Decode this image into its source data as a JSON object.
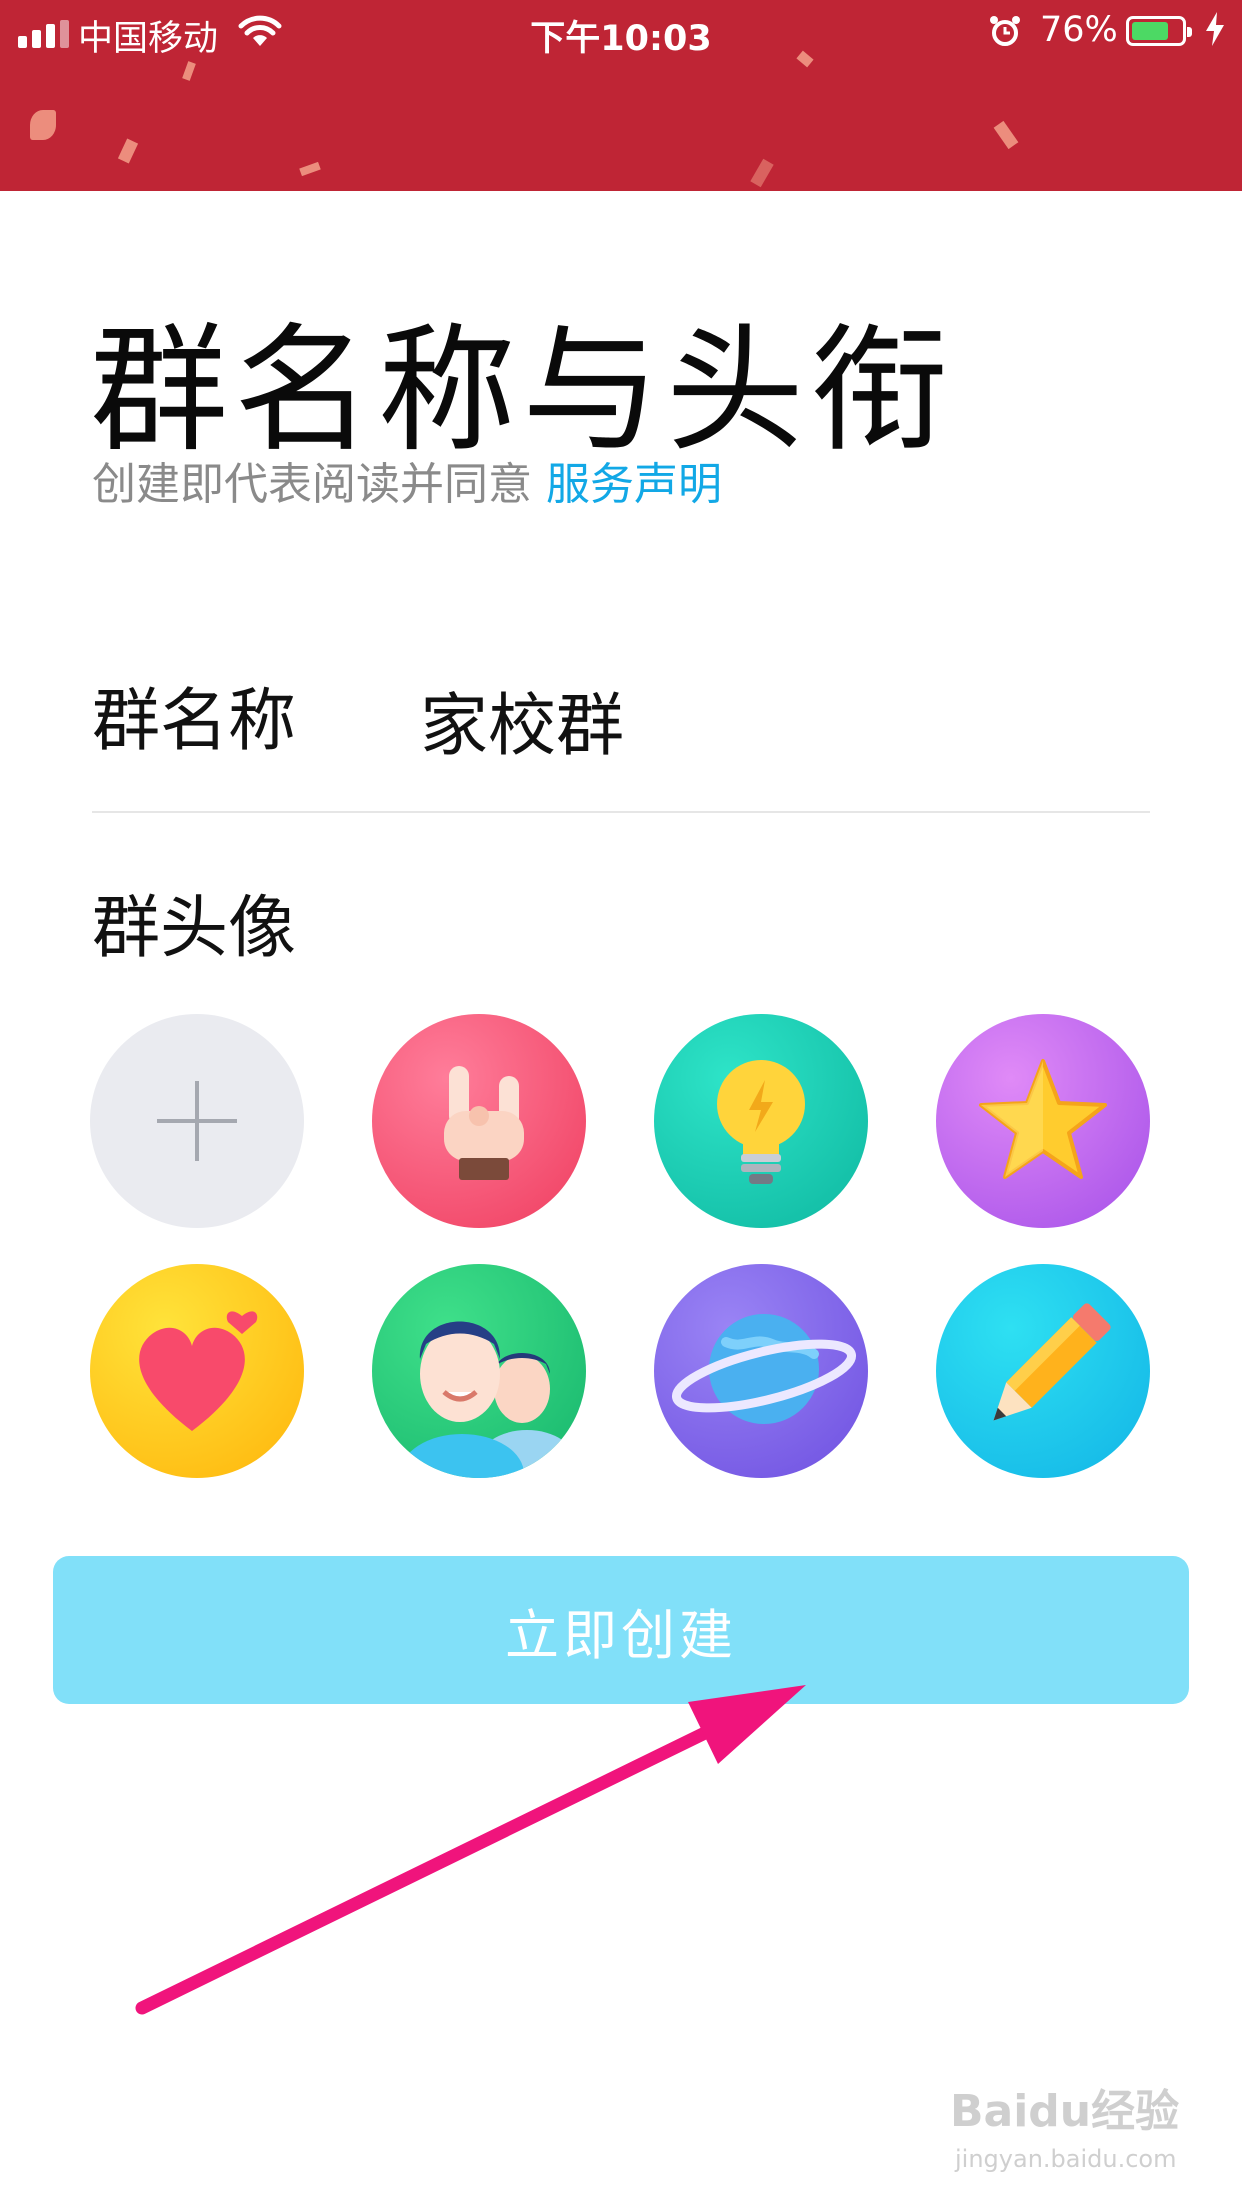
{
  "status_bar": {
    "carrier": "中国移动",
    "time": "下午10:03",
    "battery_percent": "76%",
    "battery_level": 0.76
  },
  "page": {
    "title": "群名称与头衔",
    "subtitle_prefix": "创建即代表阅读并同意",
    "subtitle_link": "服务声明"
  },
  "form": {
    "group_name_label": "群名称",
    "group_name_value": "家校群",
    "group_avatar_label": "群头像"
  },
  "avatars": [
    {
      "name": "add-avatar",
      "icon": "plus-icon"
    },
    {
      "name": "rock-hand",
      "icon": "rock-hand-icon"
    },
    {
      "name": "lightbulb",
      "icon": "lightbulb-icon"
    },
    {
      "name": "star",
      "icon": "star-icon"
    },
    {
      "name": "heart",
      "icon": "heart-icon"
    },
    {
      "name": "people",
      "icon": "people-icon"
    },
    {
      "name": "planet",
      "icon": "planet-icon"
    },
    {
      "name": "pencil",
      "icon": "pencil-icon"
    }
  ],
  "actions": {
    "create_label": "立即创建"
  },
  "watermark": {
    "brand": "Baidu经验",
    "url": "jingyan.baidu.com"
  },
  "colors": {
    "header": "#bf2535",
    "link": "#12a8e6",
    "button": "#81e0f9",
    "annotation_arrow": "#f0147c"
  }
}
